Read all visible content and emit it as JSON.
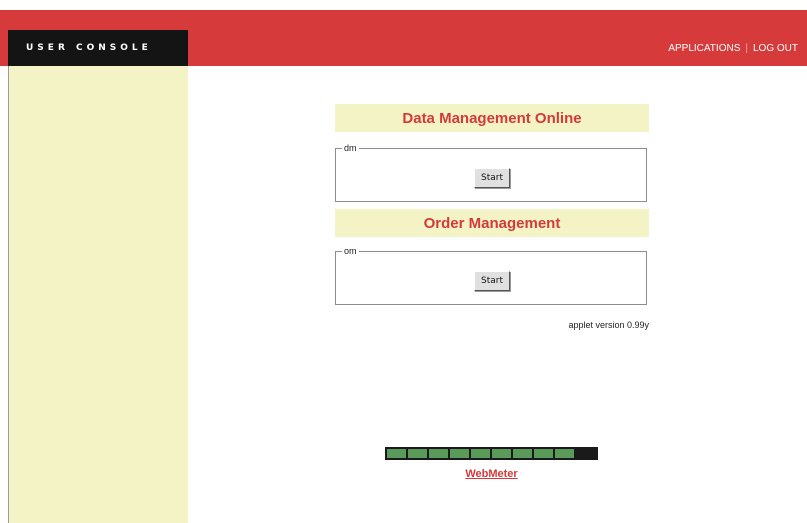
{
  "header": {
    "brand": "USER CONSOLE",
    "nav": [
      {
        "label": "APPLICATIONS"
      },
      {
        "label": "LOG OUT"
      }
    ],
    "separator": "|"
  },
  "applications": [
    {
      "title": "Data Management Online",
      "group_label": "dm",
      "button_label": "Start"
    },
    {
      "title": "Order Management",
      "group_label": "om",
      "button_label": "Start"
    }
  ],
  "footer": {
    "version": "applet version 0.99y",
    "meter_label": "WebMeter",
    "meter_fill": 0.9
  },
  "colors": {
    "header_red": "#d63a3a",
    "brand_black": "#141414",
    "sidebar_yellow": "#f3f3c6",
    "title_red": "#d53a3a",
    "meter_green": "#5a9a5a"
  }
}
